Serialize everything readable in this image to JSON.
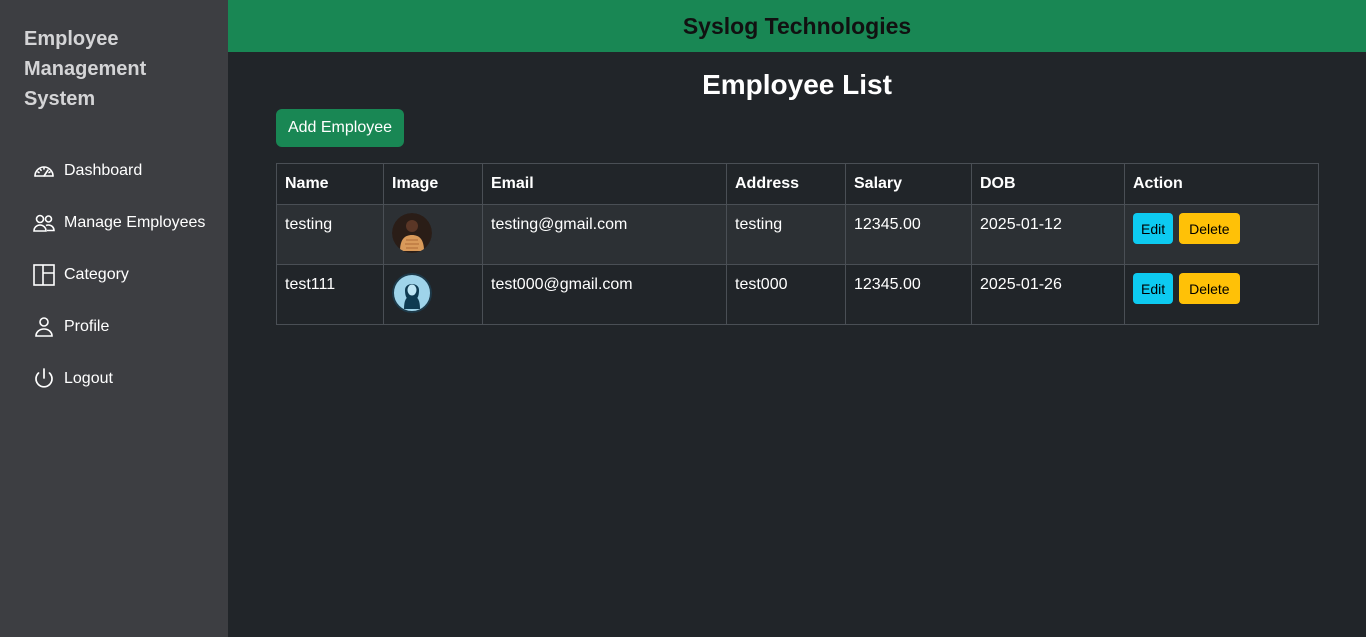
{
  "sidebar": {
    "brand": "Employee Management System",
    "items": [
      {
        "label": "Dashboard",
        "icon": "dashboard-icon"
      },
      {
        "label": "Manage Employees",
        "icon": "people-icon"
      },
      {
        "label": "Category",
        "icon": "category-icon"
      },
      {
        "label": "Profile",
        "icon": "person-icon"
      },
      {
        "label": "Logout",
        "icon": "power-icon"
      }
    ]
  },
  "header": {
    "title": "Syslog Technologies"
  },
  "main": {
    "title": "Employee List",
    "add_button": "Add Employee",
    "table": {
      "columns": [
        "Name",
        "Image",
        "Email",
        "Address",
        "Salary",
        "DOB",
        "Action"
      ],
      "rows": [
        {
          "name": "testing",
          "image": "employee-photo",
          "email": "testing@gmail.com",
          "address": "testing",
          "salary": "12345.00",
          "dob": "2025-01-12",
          "edit": "Edit",
          "delete": "Delete"
        },
        {
          "name": "test111",
          "image": "employee-avatar-placeholder",
          "email": "test000@gmail.com",
          "address": "test000",
          "salary": "12345.00",
          "dob": "2025-01-26",
          "edit": "Edit",
          "delete": "Delete"
        }
      ]
    }
  },
  "colors": {
    "sidebar_bg": "#3d3e42",
    "main_bg": "#212529",
    "header_bg": "#198754",
    "edit_btn": "#0dcaf0",
    "delete_btn": "#ffc107"
  }
}
